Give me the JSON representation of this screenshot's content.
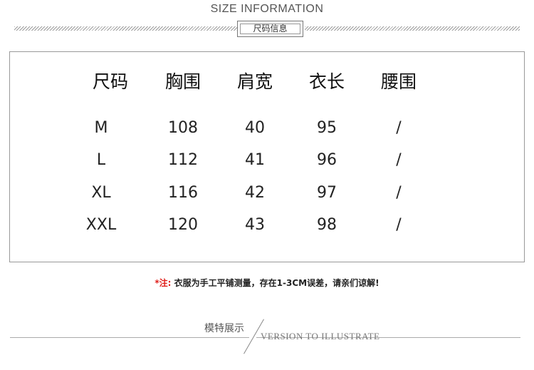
{
  "header": {
    "title": "SIZE INFORMATION",
    "subtitle": "尺码信息"
  },
  "table": {
    "headers": [
      "尺码",
      "胸围",
      "肩宽",
      "衣长",
      "腰围"
    ],
    "rows": [
      [
        "M",
        "108",
        "40",
        "95",
        "/"
      ],
      [
        "L",
        "112",
        "41",
        "96",
        "/"
      ],
      [
        "XL",
        "116",
        "42",
        "97",
        "/"
      ],
      [
        "XXL",
        "120",
        "43",
        "98",
        "/"
      ]
    ]
  },
  "note": {
    "prefix": "*注:",
    "text": "衣服为手工平铺测量，存在1-3CM误差，请亲们谅解!"
  },
  "footer": {
    "cn": "模特展示",
    "en": "VERSION TO ILLUSTRATE"
  },
  "colors": {
    "accent_red": "#e0201c",
    "border_gray": "#999999"
  }
}
